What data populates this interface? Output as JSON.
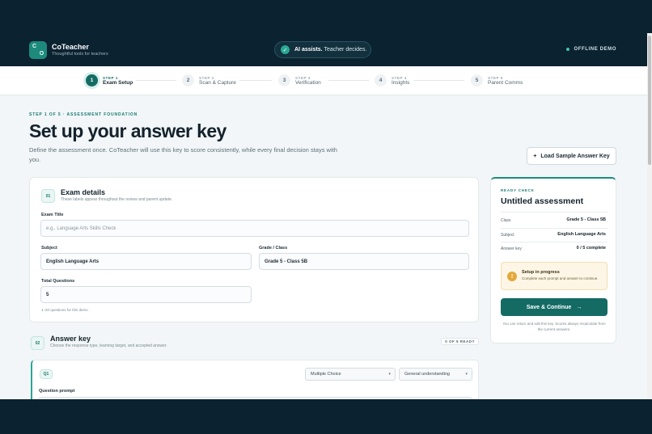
{
  "app": {
    "name": "CoTeacher",
    "tagline": "Thoughtful tools for teachers",
    "logo_letters": [
      "C",
      "O"
    ]
  },
  "header": {
    "pill_bold": "AI assists.",
    "pill_text": "Teacher decides.",
    "mode": "OFFLINE DEMO"
  },
  "steps": [
    {
      "num": "1",
      "tag": "STEP 1",
      "name": "Exam Setup",
      "active": true
    },
    {
      "num": "2",
      "tag": "STEP 2",
      "name": "Scan & Capture",
      "active": false
    },
    {
      "num": "3",
      "tag": "STEP 3",
      "name": "Verification",
      "active": false
    },
    {
      "num": "4",
      "tag": "STEP 4",
      "name": "Insights",
      "active": false
    },
    {
      "num": "5",
      "tag": "STEP 5",
      "name": "Parent Comms",
      "active": false
    }
  ],
  "page": {
    "kicker": "STEP 1 OF 5 · ASSESSMENT FOUNDATION",
    "title": "Set up your answer key",
    "intro": "Define the assessment once. CoTeacher will use this key to score consistently, while every final decision stays with you.",
    "sample_button": "Load Sample Answer Key"
  },
  "exam_details": {
    "badge": "01",
    "title": "Exam details",
    "subtitle": "These labels appear throughout the review and parent update.",
    "exam_title_label": "Exam Title",
    "exam_title_placeholder": "e.g., Language Arts Skills Check",
    "subject_label": "Subject",
    "subject_value": "English Language Arts",
    "grade_label": "Grade / Class",
    "grade_value": "Grade 5 - Class 5B",
    "total_label": "Total Questions",
    "total_value": "5",
    "total_hint": "1–20 questions for this demo"
  },
  "answer_key": {
    "badge": "02",
    "title": "Answer key",
    "subtitle": "Choose the response type, learning target, and accepted answer.",
    "ready": "0 OF 5 READY",
    "question": {
      "badge": "Q1",
      "type": "Multiple Choice",
      "target": "General understanding",
      "prompt_label": "Question prompt"
    }
  },
  "ready_check": {
    "kicker": "READY CHECK",
    "title": "Untitled assessment",
    "rows": [
      {
        "k": "Class",
        "v": "Grade 5 - Class 5B"
      },
      {
        "k": "Subject",
        "v": "English Language Arts"
      },
      {
        "k": "Answer key",
        "v": "0 / 5 complete"
      }
    ],
    "warn_title": "Setup in progress",
    "warn_text": "Complete each prompt and answer to continue.",
    "save": "Save & Continue",
    "footnote": "You can return and edit this key. Scores always recalculate from the current answers."
  }
}
